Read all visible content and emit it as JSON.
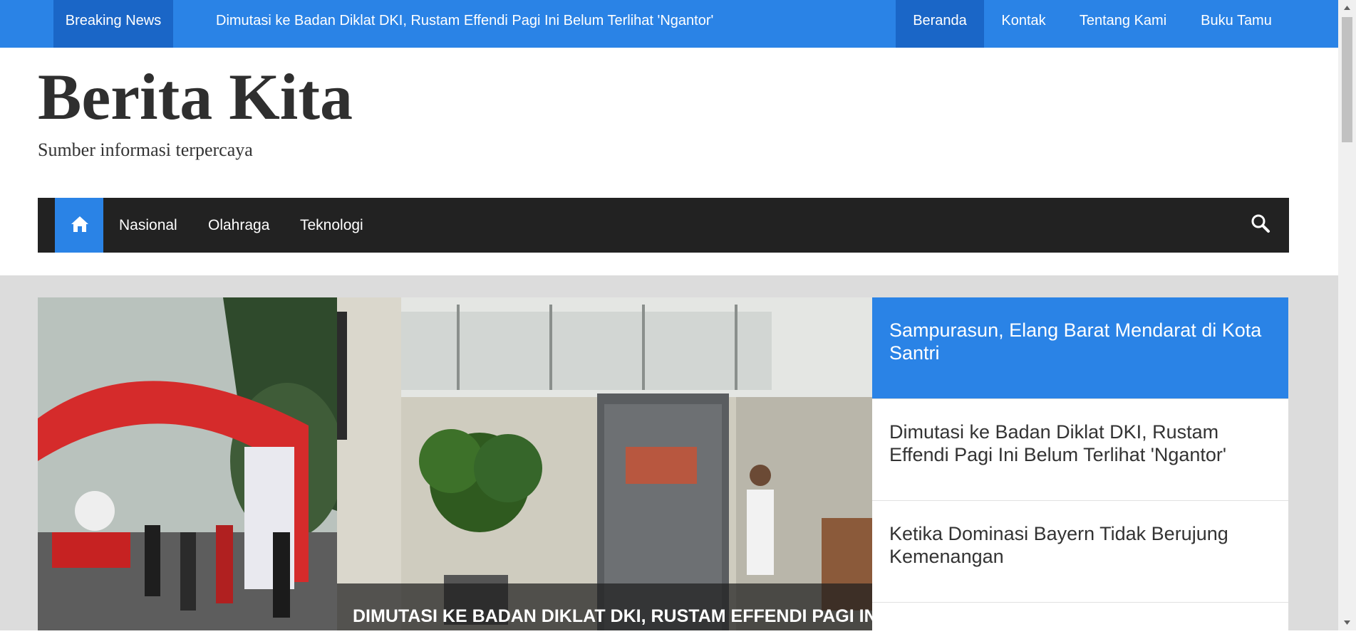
{
  "topbar": {
    "breaking_label": "Breaking News",
    "breaking_text": "Dimutasi ke Badan Diklat DKI, Rustam Effendi Pagi Ini Belum Terlihat 'Ngantor'",
    "nav": [
      "Beranda",
      "Kontak",
      "Tentang Kami",
      "Buku Tamu"
    ],
    "active_nav": "Beranda"
  },
  "header": {
    "title": "Berita Kita",
    "tagline": "Sumber informasi terpercaya"
  },
  "mainnav": {
    "home_icon": "home-icon",
    "items": [
      "Nasional",
      "Olahraga",
      "Teknologi"
    ],
    "search_icon": "search-icon"
  },
  "slider": {
    "caption": "DIMUTASI KE BADAN DIKLAT DKI, RUSTAM EFFENDI PAGI INI B"
  },
  "sidebar_list": [
    "Sampurasun, Elang Barat Mendarat di Kota Santri",
    "Dimutasi ke Badan Diklat DKI, Rustam Effendi Pagi Ini Belum Terlihat 'Ngantor'",
    "Ketika Dominasi Bayern Tidak Berujung Kemenangan"
  ],
  "colors": {
    "accent": "#2a83e6",
    "accent_dark": "#1a66c7",
    "nav_bg": "#222222",
    "content_bg": "#dcdcdc"
  }
}
